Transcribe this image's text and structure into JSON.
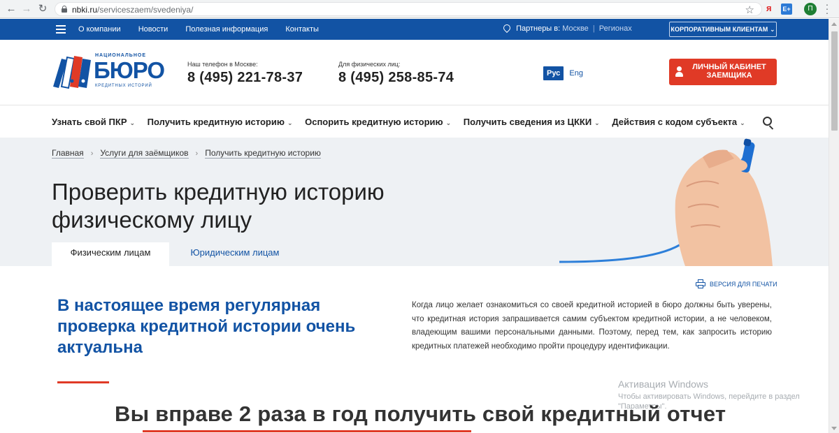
{
  "browser": {
    "url_host": "nbki.ru",
    "url_path": "/serviceszaem/svedeniya/",
    "profile_initial": "П",
    "ext_yandex": "я",
    "ext_e": "E+"
  },
  "topbar": {
    "nav": [
      "О компании",
      "Новости",
      "Полезная информация",
      "Контакты"
    ],
    "partners_label": "Партнеры в:",
    "partners_city1": "Москве",
    "partners_sep": "|",
    "partners_city2": "Регионах",
    "corp_button": "КОРПОРАТИВНЫМ КЛИЕНТАМ"
  },
  "logo": {
    "line1": "НАЦИОНАЛЬНОЕ",
    "big": "БЮРО",
    "line2": "КРЕДИТНЫХ ИСТОРИЙ"
  },
  "header": {
    "phone_moscow_label": "Наш телефон в Москве:",
    "phone_moscow": "8 (495) 221-78-37",
    "phone_individuals_label": "Для физических лиц:",
    "phone_individuals": "8 (495) 258-85-74",
    "lang_ru": "Рус",
    "lang_en": "Eng",
    "cabinet_button": "ЛИЧНЫЙ КАБИНЕТ ЗАЕМЩИКА"
  },
  "mainmenu": [
    "Узнать свой ПКР",
    "Получить кредитную историю",
    "Оспорить кредитную историю",
    "Получить сведения из ЦККИ",
    "Действия с кодом субъекта"
  ],
  "breadcrumb": [
    "Главная",
    "Услуги для заёмщиков",
    "Получить кредитную историю"
  ],
  "hero": {
    "title": "Проверить кредитную историю физическому лицу",
    "tab_active": "Физическим лицам",
    "tab_inactive": "Юридическим лицам"
  },
  "content": {
    "print_link": "ВЕРСИЯ ДЛЯ ПЕЧАТИ",
    "lead_title": "В настоящее время регулярная проверка кредитной истории очень актуальна",
    "lead_text": "Когда лицо желает ознакомиться со своей кредитной историей в бюро должны быть уверены, что кредитная история запрашивается самим субъектом кредитной истории, а не человеком, владеющим вашими персональными данными. Поэтому, перед тем, как запросить историю кредитных платежей необходимо пройти процедуру идентификации.",
    "section_title": "Вы вправе 2 раза в год получить свой кредитный отчет"
  },
  "windows_watermark": {
    "title": "Активация Windows",
    "text": "Чтобы активировать Windows, перейдите в раздел \"Параметры\"."
  },
  "colors": {
    "brand_blue": "#1253a4",
    "accent_red": "#e03a26",
    "hero_bg": "#eef1f4"
  }
}
